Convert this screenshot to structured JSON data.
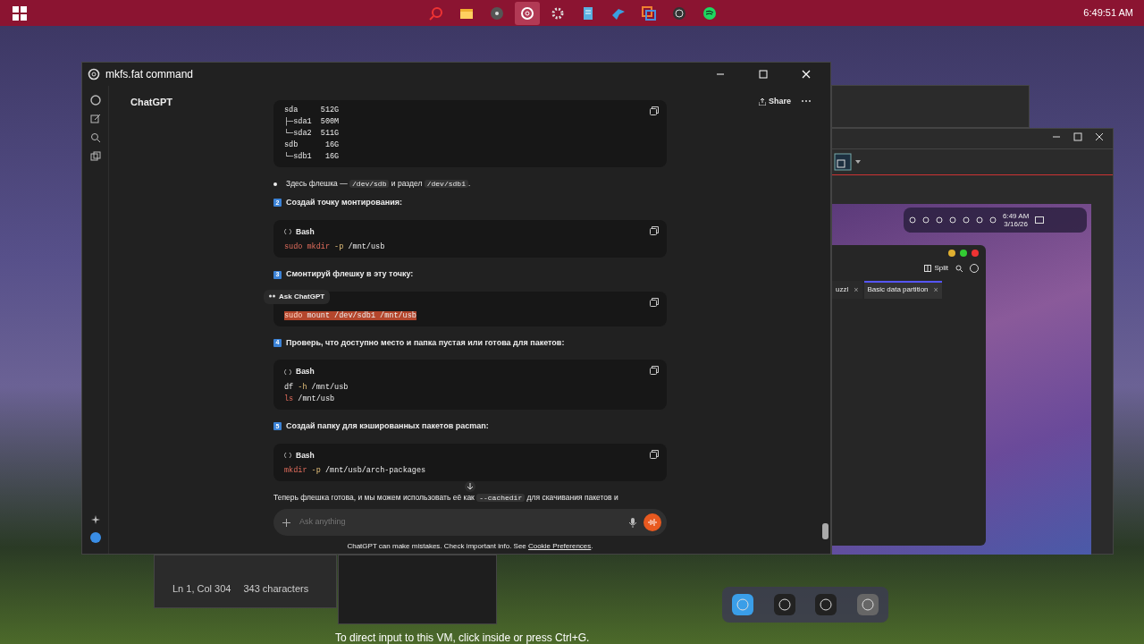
{
  "taskbar": {
    "clock": "6:49:51 AM",
    "apps": [
      {
        "selected": false
      },
      {
        "selected": false
      },
      {
        "selected": false
      },
      {
        "selected": true
      },
      {
        "selected": false
      },
      {
        "selected": false
      },
      {
        "selected": false
      },
      {
        "selected": false
      },
      {
        "selected": false
      },
      {
        "selected": false
      }
    ]
  },
  "chat_window": {
    "title": "mkfs.fat command",
    "model": "ChatGPT",
    "share": "Share",
    "blocks": [
      {
        "kind": "code",
        "lines": [
          [
            {
              "kind": "plain",
              "text": "sda     512G"
            }
          ],
          [
            {
              "kind": "plain",
              "text": "├─sda1  500M"
            }
          ],
          [
            {
              "kind": "plain",
              "text": "└─sda2  511G"
            }
          ],
          [
            {
              "kind": "plain",
              "text": "sdb      16G"
            }
          ],
          [
            {
              "kind": "plain",
              "text": "└─sdb1   16G"
            }
          ]
        ]
      },
      {
        "kind": "bullet",
        "parts": [
          {
            "kind": "text",
            "text": "Здесь флешка — "
          },
          {
            "kind": "code",
            "text": "/dev/sdb"
          },
          {
            "kind": "text",
            "text": " и раздел "
          },
          {
            "kind": "code",
            "text": "/dev/sdb1"
          },
          {
            "kind": "text",
            "text": "."
          }
        ]
      },
      {
        "kind": "step",
        "number": "2",
        "text": "Создай точку монтирования:"
      },
      {
        "kind": "code",
        "language": "Bash",
        "lines": [
          [
            {
              "kind": "keyword",
              "text": "sudo"
            },
            {
              "kind": "keyword",
              "text": " mkdir"
            },
            {
              "kind": "flag",
              "text": " -p"
            },
            {
              "kind": "plain",
              "text": " /mnt/usb"
            }
          ]
        ]
      },
      {
        "kind": "step",
        "number": "3",
        "text": "Смонтируй флешку в эту точку:"
      },
      {
        "kind": "code",
        "selected": true,
        "lines": [
          [
            {
              "kind": "keyword",
              "text": "sudo"
            },
            {
              "kind": "plain",
              "text": " mount /dev/sdb1 /mnt/usb"
            }
          ]
        ]
      },
      {
        "kind": "step",
        "number": "4",
        "text": "Проверь, что доступно место и папка пустая или готова для пакетов:"
      },
      {
        "kind": "code",
        "language": "Bash",
        "lines": [
          [
            {
              "kind": "plain",
              "text": "df "
            },
            {
              "kind": "flag",
              "text": "-h"
            },
            {
              "kind": "plain",
              "text": " /mnt/usb"
            }
          ],
          [
            {
              "kind": "keyword",
              "text": "ls"
            },
            {
              "kind": "plain",
              "text": " /mnt/usb"
            }
          ]
        ]
      },
      {
        "kind": "step",
        "number": "5",
        "text": "Создай папку для кэшированных пакетов pacman:"
      },
      {
        "kind": "code",
        "language": "Bash",
        "lines": [
          [
            {
              "kind": "keyword",
              "text": "mkdir"
            },
            {
              "kind": "flag",
              "text": " -p"
            },
            {
              "kind": "plain",
              "text": " /mnt/usb/arch-packages"
            }
          ]
        ]
      },
      {
        "kind": "paragraph",
        "parts": [
          {
            "kind": "text",
            "text": "Теперь флешка готова, и мы можем использовать её как "
          },
          {
            "kind": "code",
            "text": "--cachedir"
          },
          {
            "kind": "text",
            "text": " для скачивания пакетов и"
          }
        ]
      }
    ],
    "tooltip": "Ask ChatGPT",
    "composer": {
      "placeholder": "Ask anything"
    },
    "disclaimer": "ChatGPT can make mistakes. Check important info. See ",
    "disclaimer_link": "Cookie Preferences",
    "disclaimer_end": "."
  },
  "vm_window": {
    "clock": "6:49 AM",
    "date": "3/16/26",
    "split": "Split",
    "tabs": [
      {
        "label": "uzzl",
        "close": "×",
        "selected": false
      },
      {
        "label": "Basic data partition",
        "close": "×",
        "selected": true
      }
    ],
    "hint": "To direct input to this VM, click inside or press Ctrl+G."
  },
  "editor_status": {
    "position": "Ln 1, Col 304",
    "characters": "343 characters"
  }
}
